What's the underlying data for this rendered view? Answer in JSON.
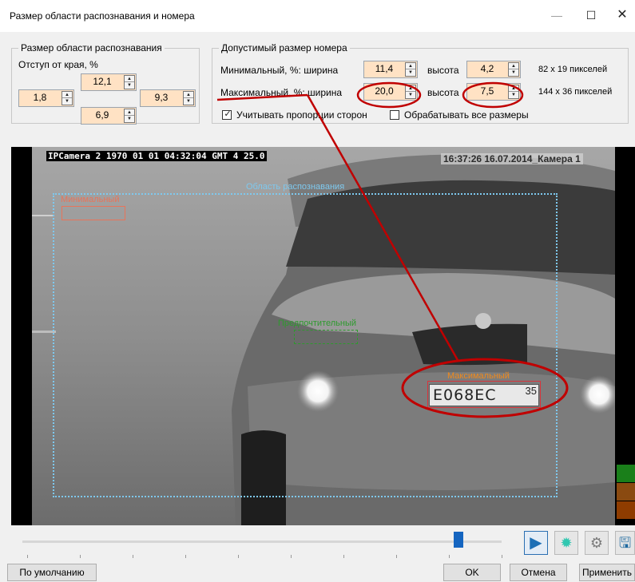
{
  "window": {
    "title": "Размер области распознавания и номера"
  },
  "area_group": {
    "legend": "Размер области распознавания",
    "offset_label": "Отступ от края, %",
    "top": "12,1",
    "left": "1,8",
    "right": "9,3",
    "bottom": "6,9"
  },
  "plate_group": {
    "legend": "Допустимый размер номера",
    "min_label": "Минимальный, %:",
    "max_label": "Максимальный, %:",
    "width_label": "ширина",
    "height_label": "высота",
    "min_width": "11,4",
    "min_height": "4,2",
    "min_pixels": "82 x 19 пикселей",
    "max_width": "20,0",
    "max_height": "7,5",
    "max_pixels": "144 x 36 пикселей",
    "keep_aspect_label": "Учитывать пропорции сторон",
    "keep_aspect_checked": true,
    "all_sizes_label": "Обрабатывать все размеры",
    "all_sizes_checked": false
  },
  "video": {
    "osd_left": "IPCamera 2 1970 01 01 04:32:04 GMT 4  25.0",
    "osd_right": "16:37:26 16.07.2014_Камера 1",
    "recognition_area_label": "Область распознавания",
    "min_zone_label": "Минимальный",
    "preferred_zone_label": "Предпочтительный",
    "max_zone_label": "Максимальный",
    "plate_text": "E068EC",
    "plate_region": "35"
  },
  "colors": {
    "min_zone": "#e8745a",
    "preferred_zone": "#2e9a2e",
    "max_zone": "#d8333a",
    "max_zone_label": "#f08a1c",
    "recognition_area": "#7ec8ee",
    "annotation": "#c00000",
    "spin_bg": "#ffe2c4"
  },
  "timeline": {
    "position": 0.9
  },
  "toolbar": {
    "play_icon": "play-icon",
    "loading_icon": "loading-icon",
    "settings_icon": "gear-icon",
    "save_icon": "save-icon"
  },
  "buttons": {
    "default_label": "По умолчанию",
    "ok_label": "OK",
    "cancel_label": "Отмена",
    "apply_label": "Применить"
  }
}
